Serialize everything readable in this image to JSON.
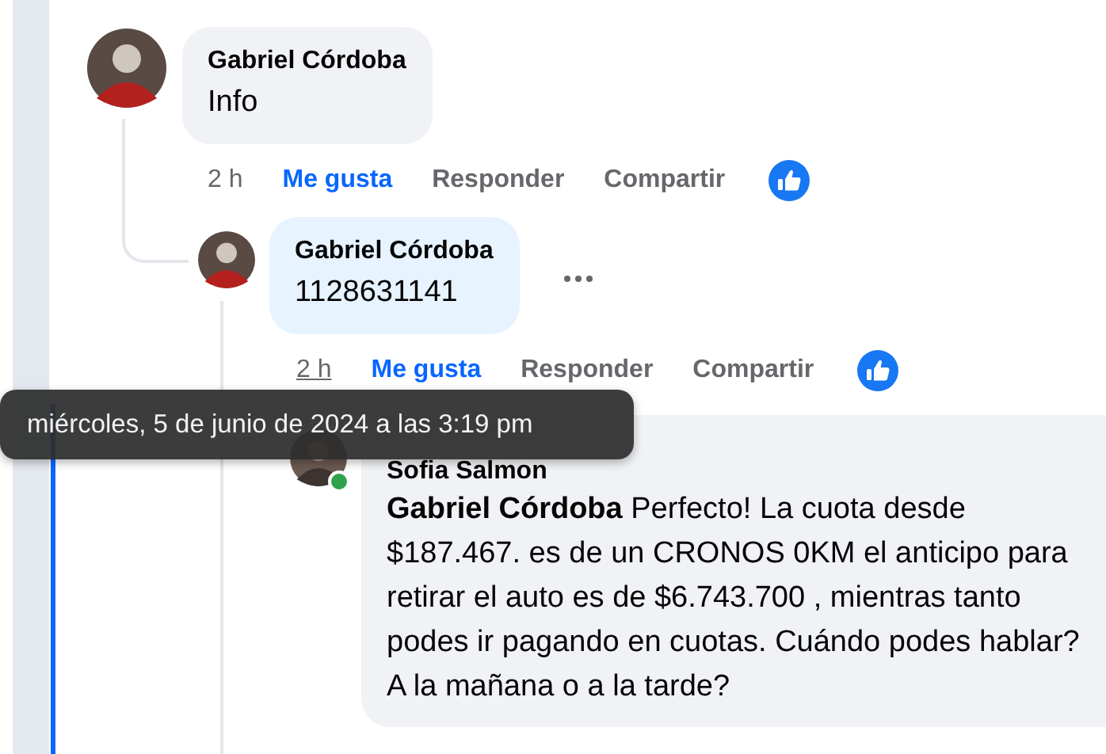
{
  "comments": [
    {
      "author": "Gabriel Córdoba",
      "text": "Info",
      "time": "2 h",
      "time_hovered": false,
      "actions": [
        "Me gusta",
        "Responder",
        "Compartir"
      ],
      "liked": true,
      "more_menu": false
    },
    {
      "author": "Gabriel Córdoba",
      "text": "1128631141",
      "time": "2 h",
      "time_hovered": true,
      "actions": [
        "Me gusta",
        "Responder",
        "Compartir"
      ],
      "liked": true,
      "more_menu": true
    }
  ],
  "reply": {
    "author": "Sofia Salmon",
    "online": true,
    "text": "**Gabriel Córdoba** Perfecto! La cuota desde $187.467. es de un CRONOS 0KM el anticipo para retirar el auto es de $6.743.700 , mientras tanto podes ir pagando en cuotas. Cuándo podes hablar? A la mañana o a la tarde?"
  },
  "tooltip": {
    "text": "miércoles, 5 de junio de 2024 a las 3:19 pm"
  }
}
